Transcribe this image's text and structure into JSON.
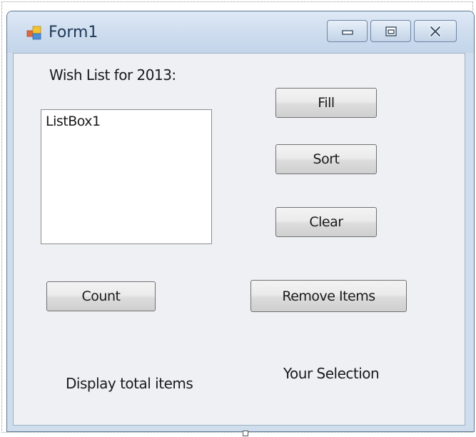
{
  "window": {
    "title": "Form1",
    "controls": {
      "minimize_icon": "minimize-icon",
      "maximize_icon": "maximize-icon",
      "close_icon": "close-icon"
    }
  },
  "form": {
    "wish_list_label": "Wish List for 2013:",
    "listbox": {
      "text": "ListBox1"
    },
    "buttons": {
      "fill": "Fill",
      "sort": "Sort",
      "clear": "Clear",
      "count": "Count",
      "remove_items": "Remove Items"
    },
    "display_total_label": "Display total items",
    "your_selection_label": "Your Selection"
  },
  "colors": {
    "title_text": "#1e3957",
    "window_frame": "#cfdded",
    "client_background": "#eef0f4"
  }
}
